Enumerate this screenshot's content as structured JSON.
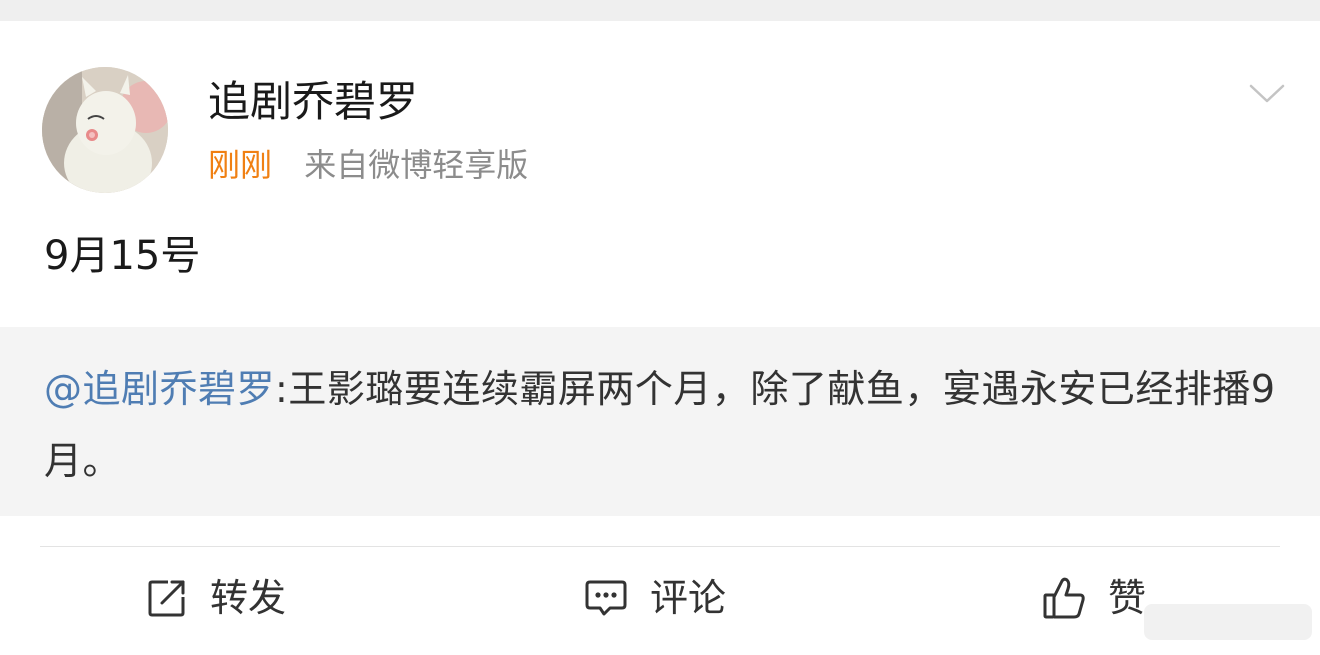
{
  "post": {
    "author": "追剧乔碧罗",
    "time": "刚刚",
    "source": "来自微博轻享版",
    "text": "9月15号"
  },
  "repost": {
    "mention": "@追剧乔碧罗",
    "text": ":王影璐要连续霸屏两个月，除了献鱼，宴遇永安已经排播9月。"
  },
  "actions": {
    "repost_label": "转发",
    "comment_label": "评论",
    "like_label": "赞"
  },
  "icons": {
    "avatar": "avatar-plush-toy",
    "menu": "chevron-down-icon",
    "repost": "share-icon",
    "comment": "comment-icon",
    "like": "thumbs-up-icon"
  },
  "colors": {
    "time": "#f08013",
    "source": "#8c8c8c",
    "mention": "#4f7db3",
    "repost_bg": "#f4f4f4"
  }
}
